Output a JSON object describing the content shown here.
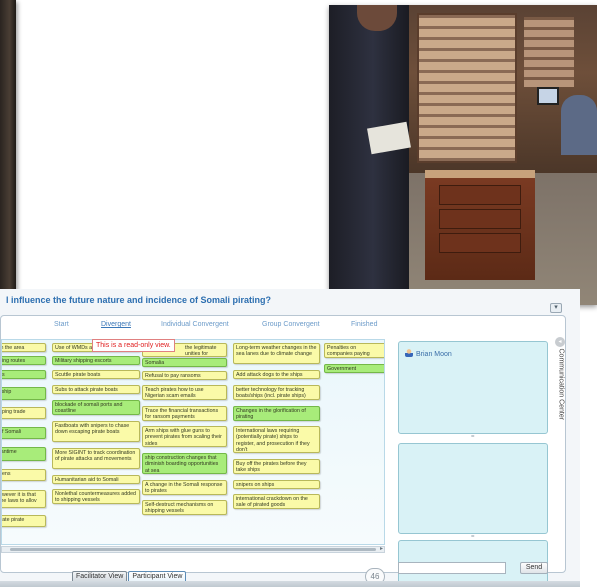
{
  "question": "l influence the future nature and incidence of Somali pirating?",
  "stages": [
    {
      "label": "Start",
      "active": false
    },
    {
      "label": "Divergent",
      "active": true
    },
    {
      "label": "Individual Convergent",
      "active": false
    },
    {
      "label": "Group Convergent",
      "active": false
    },
    {
      "label": "Finished",
      "active": false
    }
  ],
  "tooltip": "This is a read-only view.",
  "notes": [
    {
      "text": "ın the area",
      "color": "yellow"
    },
    {
      "text": "ping routes",
      "color": "green"
    },
    {
      "text": "os",
      "color": "green"
    },
    {
      "text": "l ship",
      "color": "green"
    },
    {
      "text": "pping trade",
      "color": "yellow"
    },
    {
      "text": "of Somali",
      "color": "green"
    },
    {
      "text": "rantime",
      "color": "green"
    },
    {
      "text": "dens",
      "color": "yellow"
    },
    {
      "text": "owever it is that me laws to allov",
      "color": "yellow"
    },
    {
      "text": "trate pirate",
      "color": "yellow"
    },
    {
      "text": "Use of WMDs a",
      "color": "yellow"
    },
    {
      "text": "Military shipping escorts",
      "color": "green"
    },
    {
      "text": "Scuttle pirate boats",
      "color": "yellow"
    },
    {
      "text": "Subs to attack pirate boats",
      "color": "yellow"
    },
    {
      "text": "blockade of somali ports and coastline",
      "color": "green"
    },
    {
      "text": "Fastboats with snipers to chase down escaping pirate boats",
      "color": "yellow"
    },
    {
      "text": "More SIGINT to track coordination of pirate attacks and movements",
      "color": "yellow"
    },
    {
      "text": "Humanitarian aid to Somali",
      "color": "yellow"
    },
    {
      "text": "Nonlethal countermeasures added to shipping vessels",
      "color": "yellow"
    },
    {
      "text": "the legitimate unities for",
      "color": "yellow"
    },
    {
      "text": "Somalia",
      "color": "green"
    },
    {
      "text": "Refusal to pay ransoms",
      "color": "yellow"
    },
    {
      "text": "Teach pirates how to use Nigerian scam emails",
      "color": "yellow"
    },
    {
      "text": "Trace the financial transactions for ransom payments",
      "color": "yellow"
    },
    {
      "text": "Arm ships with glue guns to prevent pirates from scaling their sides",
      "color": "yellow"
    },
    {
      "text": "ship construction changes that diminish boarding opportunities at sea",
      "color": "green"
    },
    {
      "text": "A change in the Somali response to pirates",
      "color": "yellow"
    },
    {
      "text": "Self-destruct mechanisms on shipping vessels",
      "color": "yellow"
    },
    {
      "text": "Long-term weather changes in the sea lanes due to climate change",
      "color": "yellow"
    },
    {
      "text": "Add attack dogs to the ships",
      "color": "yellow"
    },
    {
      "text": "better technology for tracking boats/ships (incl. pirate ships)",
      "color": "yellow"
    },
    {
      "text": "Changes in the glorification of pirating",
      "color": "green"
    },
    {
      "text": "International laws requiring (potentially pirate) ships to register, and prosecution if they don't",
      "color": "yellow"
    },
    {
      "text": "Buy off the pirates before they take ships",
      "color": "yellow"
    },
    {
      "text": "snipers on ships",
      "color": "yellow"
    },
    {
      "text": "international crackdown on the sale of pirated goods",
      "color": "yellow"
    },
    {
      "text": "Penalties on companies paying ransom",
      "color": "yellow"
    },
    {
      "text": "Government intervention",
      "color": "green"
    }
  ],
  "counter": "46",
  "participants": [
    "Brian Moon"
  ],
  "divider_glyph": "=",
  "communication_center": "Communication Center",
  "send_label": "Send",
  "chat_input_value": "",
  "view_tabs": [
    {
      "label": "Facilitator View",
      "active": false
    },
    {
      "label": "Participant View",
      "active": true
    }
  ],
  "icons": {
    "participant": "person-icon",
    "close": "close-icon",
    "comm": "info-icon"
  },
  "colors": {
    "note_yellow": "#fafaa8",
    "note_green": "#a8ec7a",
    "accent": "#2d6fb0",
    "tooltip_text": "#e02020"
  }
}
